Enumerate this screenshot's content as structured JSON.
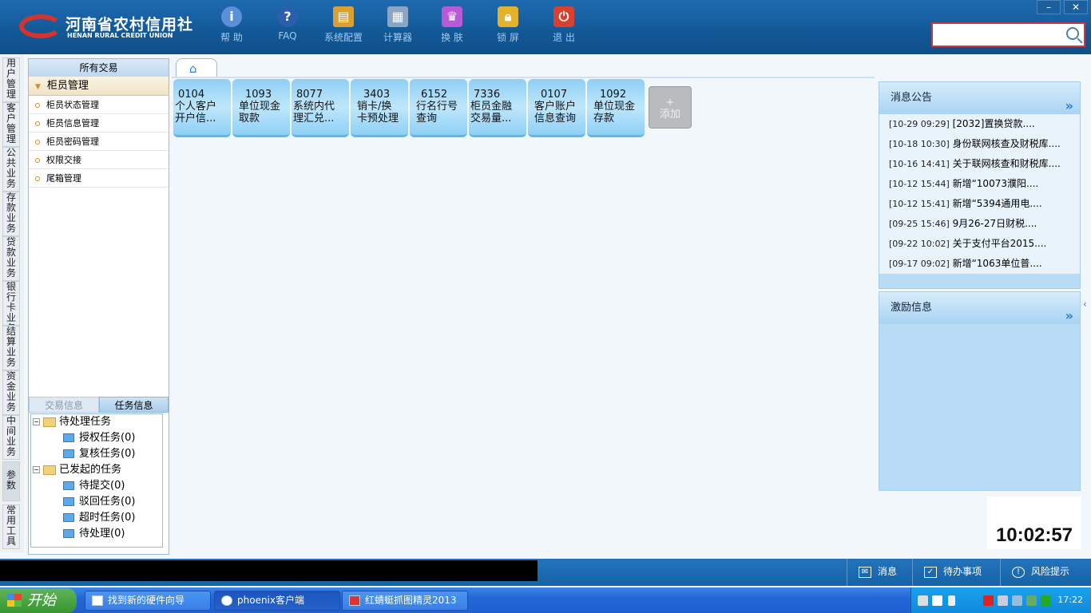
{
  "header": {
    "logo_cn": "河南省农村信用社",
    "logo_en": "HENAN RURAL CREDIT UNION",
    "toolbar": [
      {
        "label": "帮 助",
        "icon": "help-icon"
      },
      {
        "label": "FAQ",
        "icon": "faq-icon"
      },
      {
        "label": "系统配置",
        "icon": "toolbox-icon"
      },
      {
        "label": "计算器",
        "icon": "calculator-icon"
      },
      {
        "label": "换 肤",
        "icon": "shirt-icon"
      },
      {
        "label": "锁 屏",
        "icon": "lock-icon"
      },
      {
        "label": "退 出",
        "icon": "power-icon"
      }
    ],
    "minimize": "–",
    "close": "✕",
    "search_value": ""
  },
  "sidebar_tabs": [
    {
      "label": "用户管理"
    },
    {
      "label": "客户管理"
    },
    {
      "label": "公共业务"
    },
    {
      "label": "存款业务"
    },
    {
      "label": "贷款业务"
    },
    {
      "label": "银行卡业务"
    },
    {
      "label": "结算业务"
    },
    {
      "label": "资金业务"
    },
    {
      "label": "中间业务"
    },
    {
      "label": "参数"
    },
    {
      "label": "常用工具"
    }
  ],
  "menu": {
    "title": "所有交易",
    "group": "柜员管理",
    "items": [
      "柜员状态管理",
      "柜员信息管理",
      "柜员密码管理",
      "权限交接",
      "尾箱管理"
    ]
  },
  "info_tabs": {
    "tx": "交易信息",
    "task": "任务信息"
  },
  "tasks": {
    "pending": "待处理任务",
    "auth": "授权任务(0)",
    "review": "复核任务(0)",
    "initiated": "已发起的任务",
    "to_submit": "待提交(0)",
    "rejected": "驳回任务(0)",
    "timeout": "超时任务(0)",
    "to_process": "待处理(0)"
  },
  "tiles": [
    {
      "code": "0104",
      "l1": "个人客户",
      "l2": "开户信..."
    },
    {
      "code": "1093",
      "l1": "单位现金",
      "l2": "取款"
    },
    {
      "code": "8077",
      "l1": "系统内代",
      "l2": "理汇兑..."
    },
    {
      "code": "3403",
      "l1": "销卡/换",
      "l2": "卡预处理"
    },
    {
      "code": "6152",
      "l1": "行名行号",
      "l2": "查询"
    },
    {
      "code": "7336",
      "l1": "柜员金融",
      "l2": "交易量..."
    },
    {
      "code": "0107",
      "l1": "客户账户",
      "l2": "信息查询"
    },
    {
      "code": "1092",
      "l1": "单位现金",
      "l2": "存款"
    }
  ],
  "add_tile": {
    "plus": "+",
    "label": "添加"
  },
  "notices": {
    "title": "消息公告",
    "items": [
      {
        "date": "[10-29 09:29]",
        "text": "[2032]置换贷款...."
      },
      {
        "date": "[10-18 10:30]",
        "text": "身份联网核查及财税库...."
      },
      {
        "date": "[10-16 14:41]",
        "text": "关于联网核查和财税库...."
      },
      {
        "date": "[10-12 15:44]",
        "text": "新增“10073濮阳...."
      },
      {
        "date": "[10-12 15:41]",
        "text": "新增“5394通用电...."
      },
      {
        "date": "[09-25 15:46]",
        "text": "9月26-27日财税...."
      },
      {
        "date": "[09-22 10:02]",
        "text": "关于支付平台2015...."
      },
      {
        "date": "[09-17 09:02]",
        "text": "新增“1063单位普...."
      }
    ]
  },
  "incentive": {
    "title": "激励信息"
  },
  "clock": "10:02:57",
  "status": {
    "message": "消息",
    "todo": "待办事项",
    "risk": "风险提示"
  },
  "taskbar": {
    "start": "开始",
    "items": [
      "找到新的硬件向导",
      "phoenix客户端",
      "红蜻蜓抓图精灵2013"
    ],
    "time": "17:22"
  }
}
